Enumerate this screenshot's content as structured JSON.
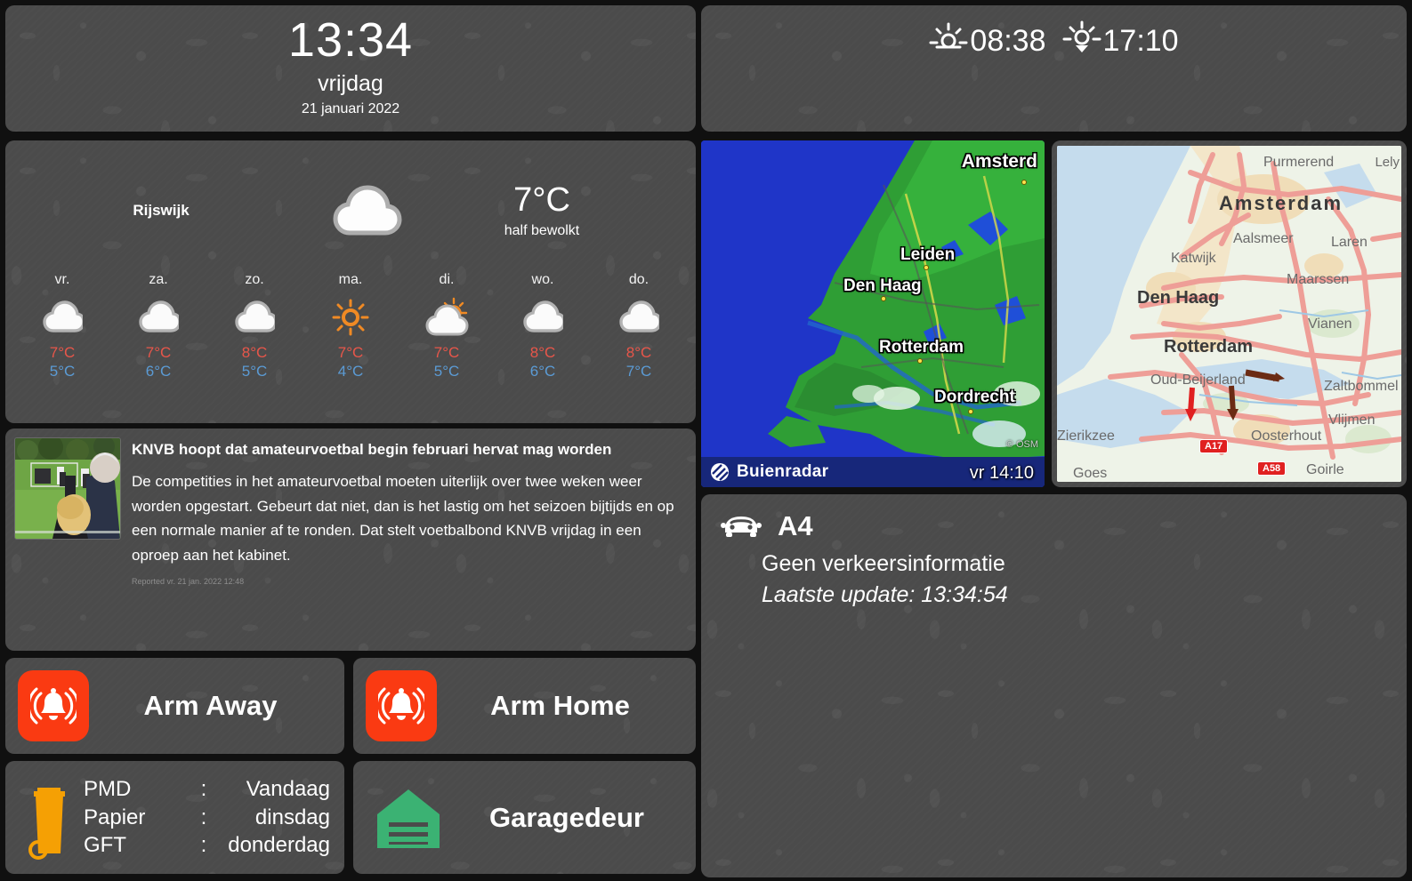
{
  "clock": {
    "time": "13:34",
    "day": "vrijdag",
    "date": "21 januari 2022"
  },
  "sun": {
    "sunrise_icon": "sunrise-icon",
    "sunrise": "08:38",
    "sunset_icon": "sunset-icon",
    "sunset": "17:10"
  },
  "weather": {
    "city": "Rijswijk",
    "icon": "cloud-icon",
    "temperature": "7°C",
    "description": "half bewolkt",
    "forecast": [
      {
        "day": "vr.",
        "icon": "cloud-icon",
        "high": "7°C",
        "low": "5°C"
      },
      {
        "day": "za.",
        "icon": "cloud-icon",
        "high": "7°C",
        "low": "6°C"
      },
      {
        "day": "zo.",
        "icon": "cloud-icon",
        "high": "8°C",
        "low": "5°C"
      },
      {
        "day": "ma.",
        "icon": "sun-icon",
        "high": "7°C",
        "low": "4°C"
      },
      {
        "day": "di.",
        "icon": "sun-cloud-icon",
        "high": "7°C",
        "low": "5°C"
      },
      {
        "day": "wo.",
        "icon": "cloud-icon",
        "high": "8°C",
        "low": "6°C"
      },
      {
        "day": "do.",
        "icon": "cloud-icon",
        "high": "8°C",
        "low": "7°C"
      }
    ],
    "colors": {
      "high": "#e8564a",
      "low": "#5b9bd5"
    }
  },
  "news": {
    "thumbnail_alt": "amateur football match photo",
    "title": "KNVB hoopt dat amateurvoetbal begin februari hervat mag worden",
    "body": "De competities in het amateurvoetbal moeten uiterlijk over twee weken weer worden opgestart. Gebeurt dat niet, dan is het lastig om het seizoen bijtijds en op een normale manier af te ronden. Dat stelt voetbalbond KNVB vrijdag in een oproep aan het kabinet.",
    "meta": "Reported vr. 21 jan. 2022 12:48"
  },
  "alarm": {
    "arm_away_label": "Arm Away",
    "arm_home_label": "Arm Home",
    "icon": "alarm-bell-icon",
    "icon_color": "#fa3a12"
  },
  "trash": {
    "icon": "trash-bin-icon",
    "icon_color": "#f5a004",
    "separator": ":",
    "items": [
      {
        "type": "PMD",
        "day": "Vandaag"
      },
      {
        "type": "Papier",
        "day": "dinsdag"
      },
      {
        "type": "GFT",
        "day": "donderdag"
      }
    ]
  },
  "garage": {
    "icon": "garage-door-icon",
    "icon_color": "#3bb273",
    "label": "Garagedeur"
  },
  "radar": {
    "brand": "Buienradar",
    "logo_icon": "buienradar-logo-icon",
    "timestamp": "vr 14:10",
    "attribution": "© OSM",
    "cities": [
      "Amsterd",
      "Leiden",
      "Den Haag",
      "Rotterdam",
      "Dordrecht"
    ]
  },
  "traffic_map": {
    "labels": [
      "Purmerend",
      "Lely",
      "Amsterdam",
      "Aalsmeer",
      "Laren",
      "Katwijk",
      "Maarssen",
      "Den Haag",
      "Vianen",
      "Rotterdam",
      "Oud-Beijerland",
      "Zaltbommel",
      "Zierikzee",
      "Oosterhout",
      "Vlijmen",
      "Goes",
      "Goirle"
    ],
    "road_shields": [
      "A17",
      "A58"
    ]
  },
  "traffic_info": {
    "icon": "car-icon",
    "road": "A4",
    "status": "Geen verkeersinformatie",
    "update": "Laatste update: 13:34:54"
  }
}
